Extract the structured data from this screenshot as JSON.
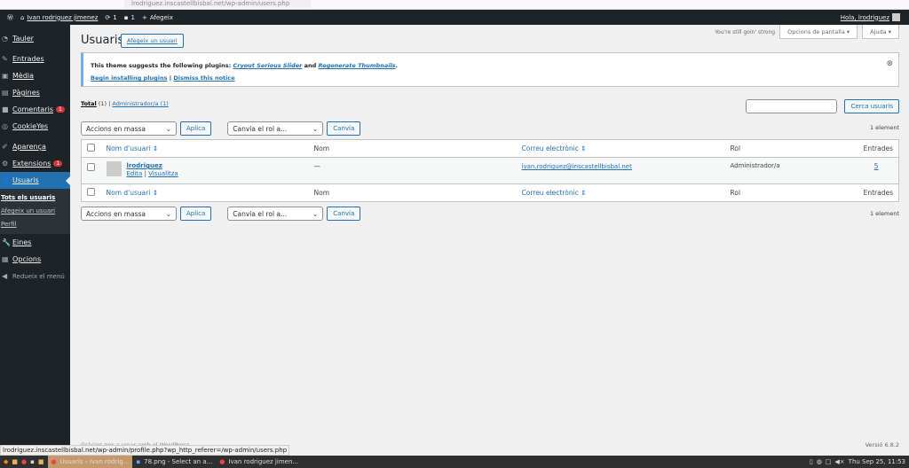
{
  "browser": {
    "url": "lrodriguez.inscastellbisbal.net/wp-admin/users.php"
  },
  "adminbar": {
    "site": "Ivan rodriguez jimenez",
    "updates": "1",
    "comments": "1",
    "new": "Afegeix",
    "howdy": "Hola, lrodriguez"
  },
  "sidebar": {
    "items": [
      {
        "label": "Tauler",
        "icon": "dashboard-icon"
      },
      {
        "label": "Entrades",
        "icon": "pin-icon"
      },
      {
        "label": "Mèdia",
        "icon": "media-icon"
      },
      {
        "label": "Pàgines",
        "icon": "pages-icon"
      },
      {
        "label": "Comentaris",
        "icon": "comments-icon",
        "badge": "1"
      },
      {
        "label": "CookieYes",
        "icon": "cookie-icon"
      },
      {
        "label": "Aparença",
        "icon": "appearance-icon"
      },
      {
        "label": "Extensions",
        "icon": "plugins-icon",
        "badge": "1"
      },
      {
        "label": "Usuaris",
        "icon": "users-icon"
      }
    ],
    "sub": [
      "Tots els usuaris",
      "Afegeix un usuari",
      "Perfil"
    ],
    "after": [
      {
        "label": "Eines"
      },
      {
        "label": "Opcions"
      },
      {
        "label": "Redueix el menú"
      }
    ]
  },
  "header": {
    "title": "Usuaris",
    "add": "Afegeix un usuari",
    "tagline": "You're still goin' strong",
    "screen_options": "Opcions de pantalla",
    "help": "Ajuda"
  },
  "notice": {
    "text": "This theme suggests the following plugins:",
    "p1": "Cryout Serious Slider",
    "and": "and",
    "p2": "Regenerate Thumbnails",
    "begin": "Begin installing plugins",
    "sep": "|",
    "dismiss": "Dismiss this notice"
  },
  "filters": {
    "total": "Total",
    "total_count": "(1)",
    "admin": "Administrador/a",
    "admin_count": "(1)"
  },
  "search": {
    "value": "",
    "button": "Cerca usuaris"
  },
  "actions": {
    "bulk": "Accions en massa",
    "apply": "Aplica",
    "role": "Canvia el rol a...",
    "change": "Canvia",
    "count": "1 element"
  },
  "table": {
    "columns": [
      "Nom d'usuari",
      "Nom",
      "Correu electrònic",
      "Rol",
      "Entrades"
    ],
    "rows": [
      {
        "username": "lrodriguez",
        "name": "—",
        "email": "ivan.rodriguez@inscastellbisbal.net",
        "role": "Administrador/a",
        "posts": "5",
        "edit": "Edita",
        "view": "Visualitza"
      }
    ]
  },
  "footer": {
    "thanks": "Gràcies per a crear amb el WordPress.",
    "version": "Versió 6.8.2"
  },
  "status_url": "lrodriguez.inscastellbisbal.net/wp-admin/profile.php?wp_http_referer=/wp-admin/users.php",
  "taskbar": {
    "windows": [
      "Usuaris ‹ Ivan rodrig...",
      "78.png - Select an a...",
      "Ivan rodriguez jimen..."
    ],
    "clock": "Thu Sep 25, 11:53"
  }
}
